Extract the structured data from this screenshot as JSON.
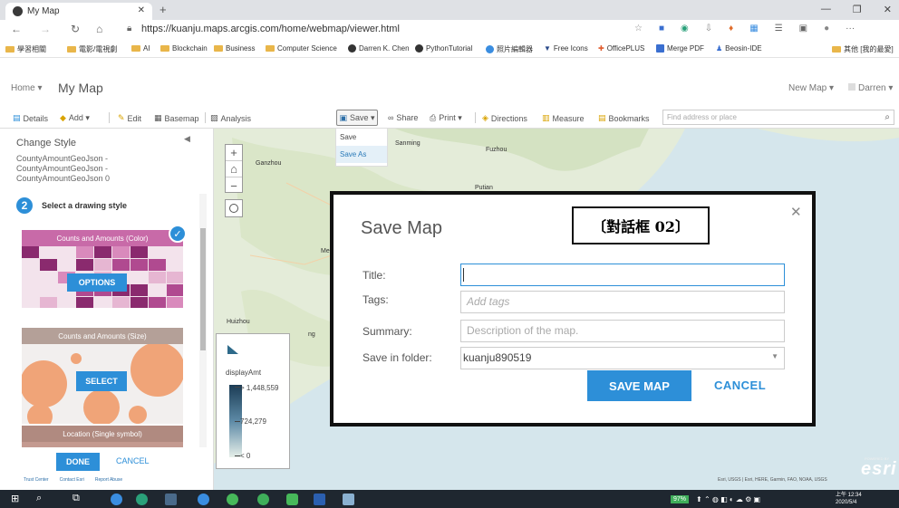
{
  "browser": {
    "tab_title": "My Map",
    "url": "https://kuanju.maps.arcgis.com/home/webmap/viewer.html",
    "bookmarks": [
      "學習相關",
      "電影/電視劇",
      "AI",
      "Blockchain",
      "Business",
      "Computer Science",
      "Darren K. Chen",
      "PythonTutorial",
      "照片編輯器",
      "Free Icons",
      "OfficePLUS",
      "Merge PDF",
      "Beosin-IDE"
    ],
    "other_bookmarks": "其他 [我的最愛]"
  },
  "app": {
    "home_label": "Home ▾",
    "map_title": "My Map",
    "new_map": "New Map ▾",
    "user": "Darren ▾"
  },
  "toolbar": {
    "details": "Details",
    "add": "Add ▾",
    "edit": "Edit",
    "basemap": "Basemap",
    "analysis": "Analysis",
    "save": "Save ▾",
    "share": "Share",
    "print": "Print ▾",
    "directions": "Directions",
    "measure": "Measure",
    "bookmarks": "Bookmarks",
    "search_placeholder": "Find address or place"
  },
  "save_menu": {
    "save": "Save",
    "save_as": "Save As"
  },
  "sidebar": {
    "title": "Change Style",
    "layer_name": "CountyAmountGeoJson - CountyAmountGeoJson - CountyAmountGeoJson 0",
    "step_number": "2",
    "step_label": "Select a drawing style",
    "cards": [
      {
        "title": "Counts and Amounts (Color)",
        "button": "OPTIONS"
      },
      {
        "title": "Counts and Amounts (Size)",
        "button": "SELECT"
      },
      {
        "title": "Location (Single symbol)"
      }
    ],
    "done": "DONE",
    "cancel": "CANCEL",
    "footer_links": [
      "Trust Center",
      "Contact Esri",
      "Report Abuse"
    ]
  },
  "map": {
    "labels": [
      "Sanming",
      "Fuzhou",
      "Putian",
      "Ganzhou",
      "Huizhou",
      "Me",
      "ng",
      "S"
    ],
    "legend": {
      "field": "displayAmt",
      "high": "> 1,448,559",
      "mid": "724,279",
      "low": "< 0"
    },
    "attribution": "Esri, USGS | Esri, HERE, Garmin, FAO, NOAA, USGS",
    "esri_logo": "esri",
    "powered_by": "POWERED BY"
  },
  "dialog": {
    "title": "Save Map",
    "annotation_tag": "〔對話框 02〕",
    "title_label": "Title:",
    "title_value": "",
    "tags_label": "Tags:",
    "tags_placeholder": "Add tags",
    "summary_label": "Summary:",
    "summary_placeholder": "Description of the map.",
    "folder_label": "Save in folder:",
    "folder_value": "kuanju890519",
    "save_button": "SAVE MAP",
    "cancel_button": "CANCEL"
  },
  "taskbar": {
    "battery": "97%",
    "time": "上午 12:34",
    "date": "2020/5/4"
  },
  "colors": {
    "accent": "#2d8fd8",
    "card_color_header": "#c86aa8",
    "card_size_header": "#b4a098",
    "card_location_header": "#b08a80"
  }
}
